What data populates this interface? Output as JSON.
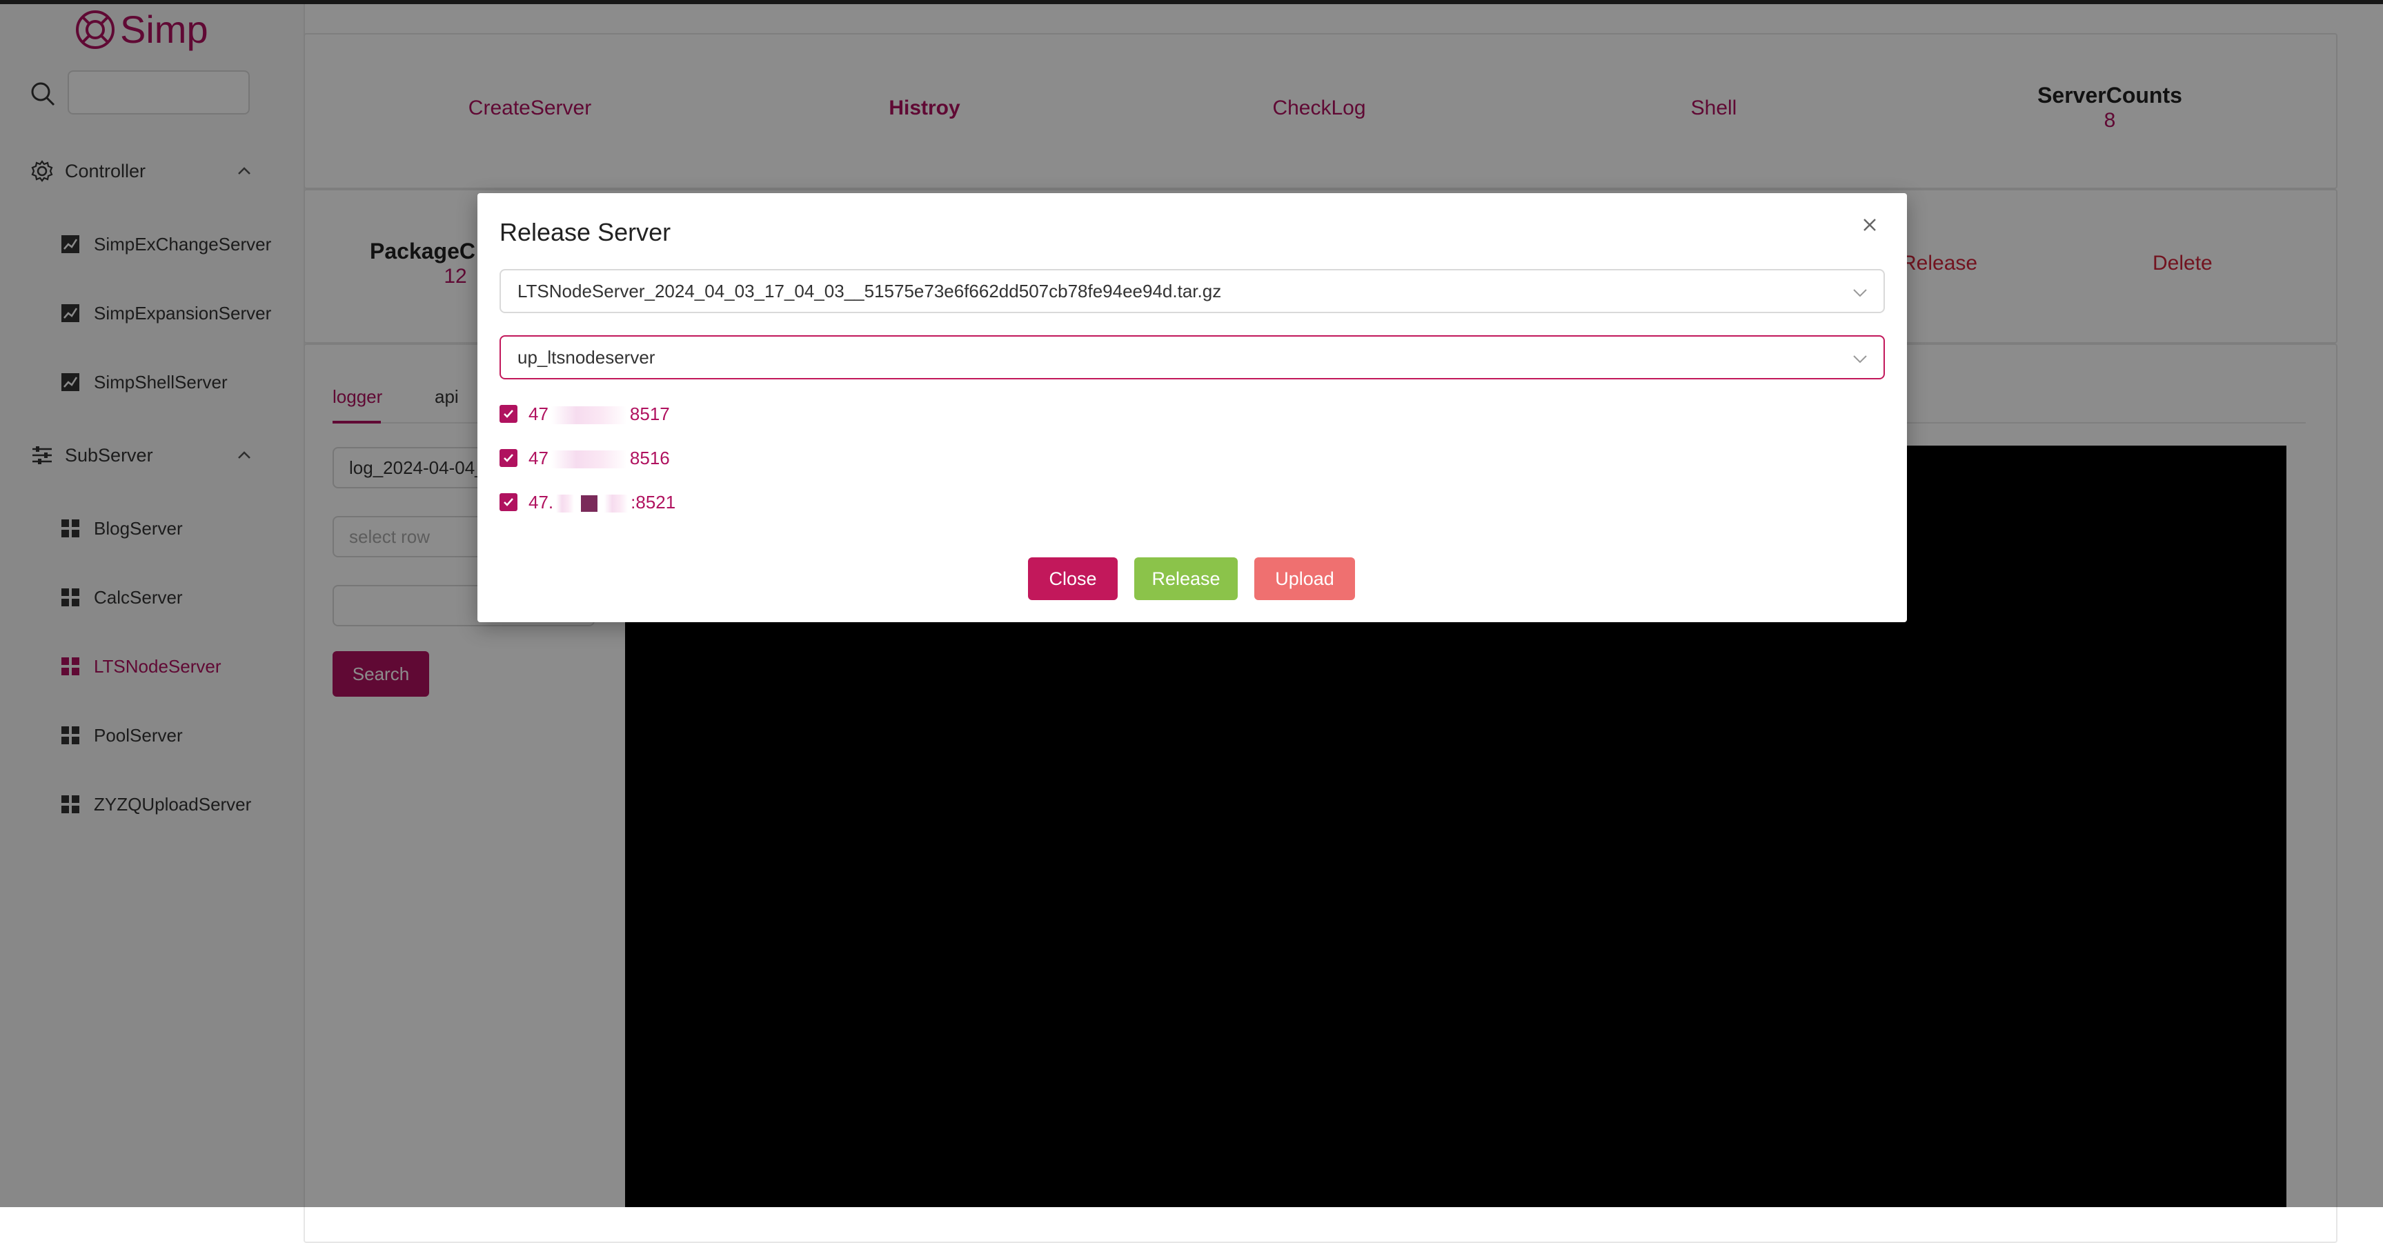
{
  "app": {
    "logo_text": "Simp",
    "accent": "#b0125f"
  },
  "sidebar": {
    "search_placeholder": "",
    "groups": [
      {
        "label": "Controller",
        "icon": "gear-icon",
        "expanded": true,
        "items": [
          {
            "label": "SimpExChangeServer",
            "icon": "chart-icon"
          },
          {
            "label": "SimpExpansionServer",
            "icon": "chart-icon"
          },
          {
            "label": "SimpShellServer",
            "icon": "chart-icon"
          }
        ]
      },
      {
        "label": "SubServer",
        "icon": "sliders-icon",
        "expanded": true,
        "items": [
          {
            "label": "BlogServer",
            "icon": "grid-icon"
          },
          {
            "label": "CalcServer",
            "icon": "grid-icon"
          },
          {
            "label": "LTSNodeServer",
            "icon": "grid-icon",
            "active": true
          },
          {
            "label": "PoolServer",
            "icon": "grid-icon"
          },
          {
            "label": "ZYZQUploadServer",
            "icon": "grid-icon"
          }
        ]
      }
    ]
  },
  "nav": {
    "links": [
      "CreateServer",
      "Histroy",
      "CheckLog",
      "Shell"
    ],
    "server_counts_label": "ServerCounts",
    "server_counts_value": "8"
  },
  "package": {
    "label": "PackageC",
    "value": "12",
    "release": "Release",
    "delete": "Delete"
  },
  "log_panel": {
    "tabs": [
      "logger",
      "api"
    ],
    "log_file_value": "log_2024-04-04_",
    "row_placeholder": "select row",
    "search_label": "Search"
  },
  "modal": {
    "title": "Release Server",
    "package_value": "LTSNodeServer_2024_04_03_17_04_03__51575e73e6f662dd507cb78fe94ee94d.tar.gz",
    "target_value": "up_ltsnodeserver",
    "servers": [
      {
        "prefix": "47",
        "suffix": "8517",
        "checked": true
      },
      {
        "prefix": "47",
        "suffix": "8516",
        "checked": true
      },
      {
        "prefix": "47.",
        "suffix": ":8521",
        "checked": true
      }
    ],
    "buttons": {
      "close": "Close",
      "release": "Release",
      "upload": "Upload"
    },
    "colors": {
      "close": "#c2185b",
      "release": "#8bc34a",
      "upload": "#ef7070"
    }
  }
}
